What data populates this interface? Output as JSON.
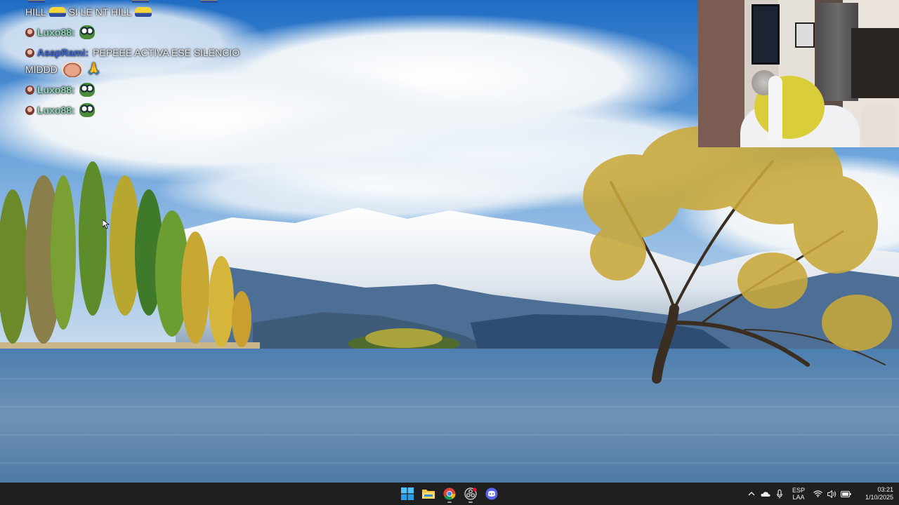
{
  "chat": {
    "lines": [
      {
        "type": "partial",
        "text": ""
      },
      {
        "type": "message",
        "text": "HILL",
        "text2": "SI LE NT HILL"
      },
      {
        "type": "message",
        "user": "Luxo88:",
        "user_color": "#8fd6b6",
        "emote": "pepe"
      },
      {
        "type": "message",
        "user": "AsapRami:",
        "user_color": "#3c69e0",
        "text": "PEPEEE ACTIVA ESE SILENCIO",
        "text2": "MIDDD"
      },
      {
        "type": "message",
        "user": "Luxo88:",
        "user_color": "#8fd6b6",
        "emote": "pepe"
      },
      {
        "type": "message",
        "user": "Luxo88:",
        "user_color": "#8fd6b6",
        "emote": "pepe"
      }
    ]
  },
  "taskbar": {
    "pinned": [
      "windows-start-icon",
      "file-explorer-icon",
      "chrome-icon",
      "obs-icon",
      "discord-icon"
    ],
    "tray": {
      "lang_line1": "ESP",
      "lang_line2": "LAA",
      "time": "03:21",
      "date": "1/10/2025"
    }
  }
}
